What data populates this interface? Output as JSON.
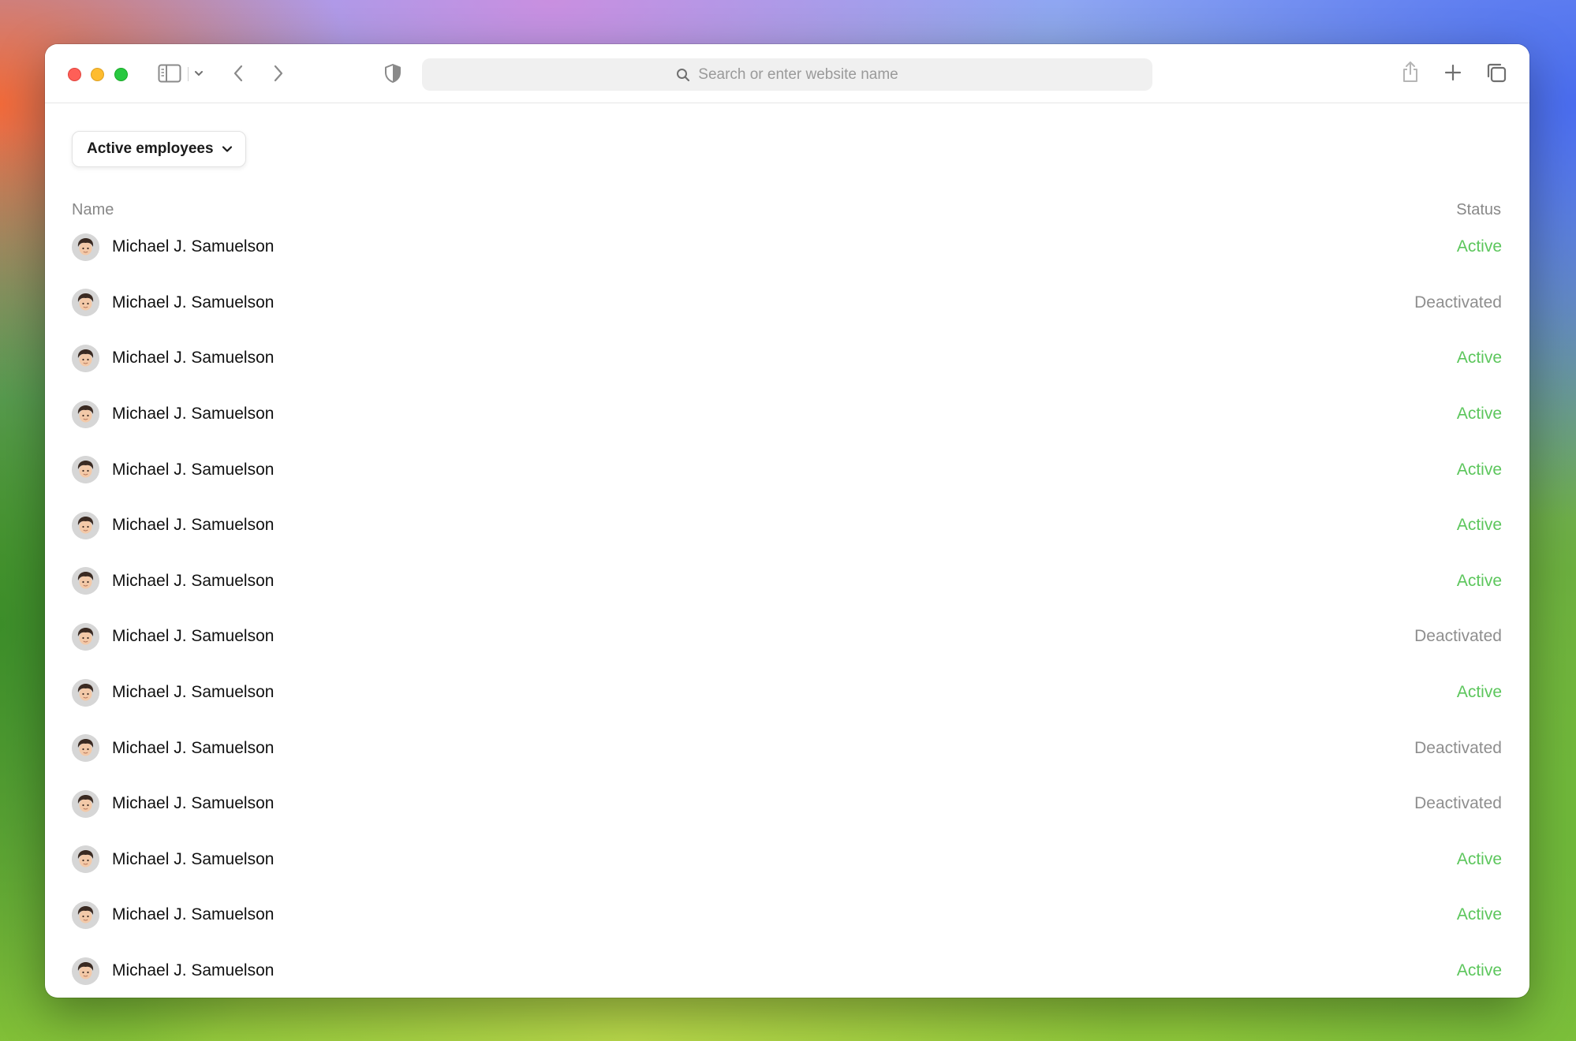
{
  "browser": {
    "address_placeholder": "Search or enter website name"
  },
  "filter": {
    "label": "Active employees"
  },
  "table": {
    "headers": {
      "name": "Name",
      "status": "Status"
    },
    "rows": [
      {
        "name": "Michael J. Samuelson",
        "status": "Active"
      },
      {
        "name": "Michael J. Samuelson",
        "status": "Deactivated"
      },
      {
        "name": "Michael J. Samuelson",
        "status": "Active"
      },
      {
        "name": "Michael J. Samuelson",
        "status": "Active"
      },
      {
        "name": "Michael J. Samuelson",
        "status": "Active"
      },
      {
        "name": "Michael J. Samuelson",
        "status": "Active"
      },
      {
        "name": "Michael J. Samuelson",
        "status": "Active"
      },
      {
        "name": "Michael J. Samuelson",
        "status": "Deactivated"
      },
      {
        "name": "Michael J. Samuelson",
        "status": "Active"
      },
      {
        "name": "Michael J. Samuelson",
        "status": "Deactivated"
      },
      {
        "name": "Michael J. Samuelson",
        "status": "Deactivated"
      },
      {
        "name": "Michael J. Samuelson",
        "status": "Active"
      },
      {
        "name": "Michael J. Samuelson",
        "status": "Active"
      },
      {
        "name": "Michael J. Samuelson",
        "status": "Active"
      }
    ]
  },
  "colors": {
    "active": "#5cc65c",
    "deactivated": "#8e8e8e"
  }
}
